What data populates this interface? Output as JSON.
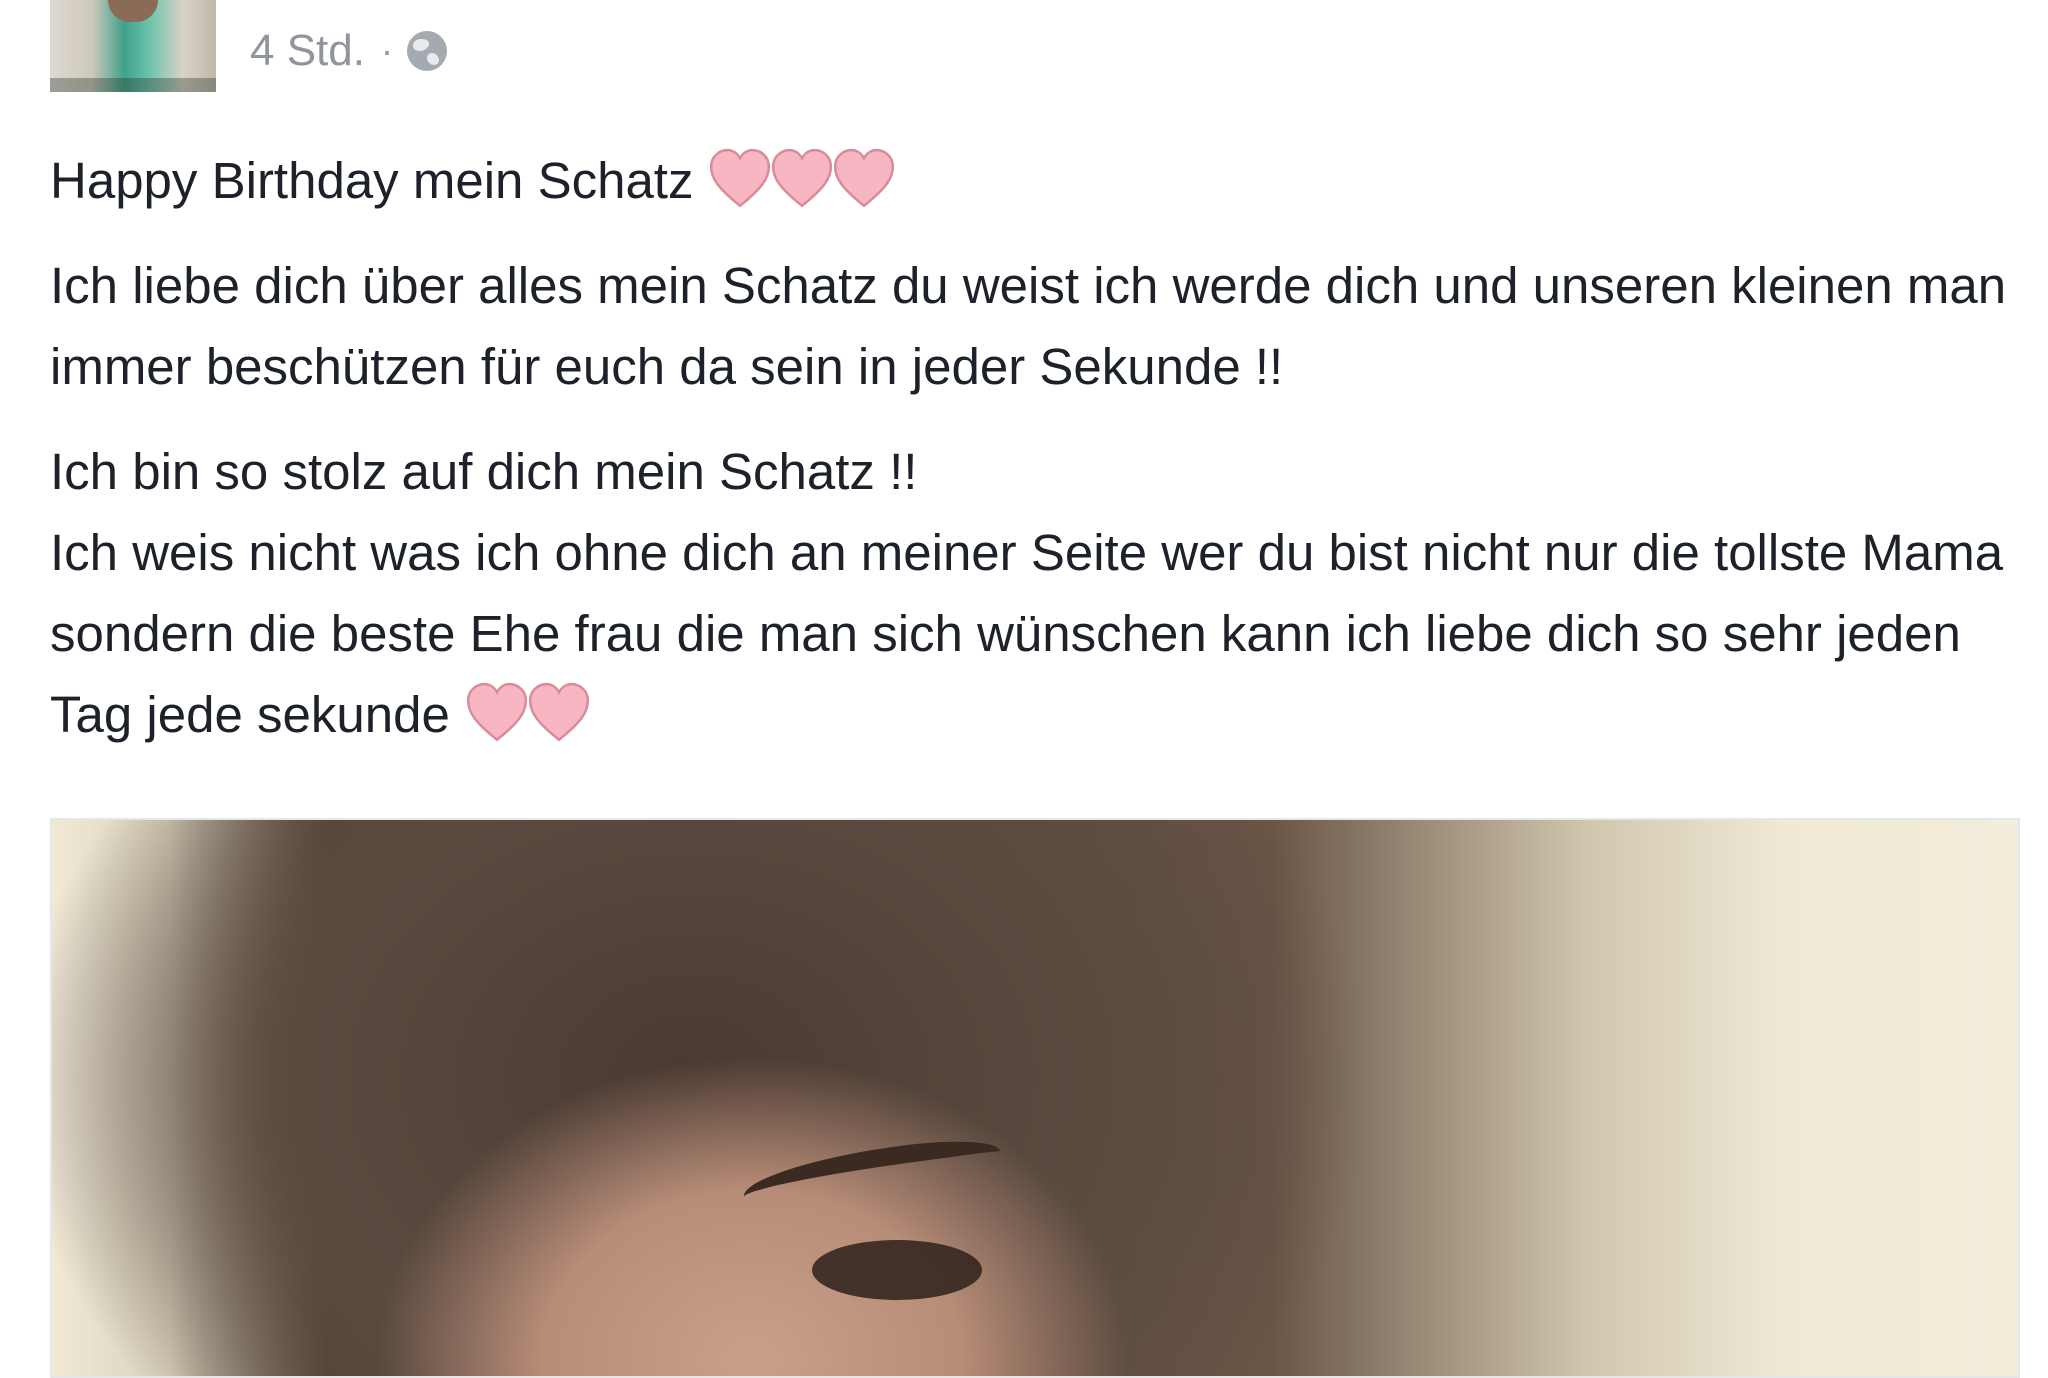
{
  "post": {
    "time": "4 Std.",
    "separator": "·",
    "privacy_icon": "globe-icon",
    "line1": "Happy Birthday mein Schatz",
    "para2": "Ich liebe dich über alles mein Schatz du weist ich werde dich und unseren kleinen man immer beschützen für euch da sein in jeder Sekunde !!",
    "line3": "Ich bin so stolz auf dich mein Schatz !!",
    "para4": "Ich weis nicht was ich ohne dich an meiner Seite wer du bist nicht nur die tollste Mama sondern die beste Ehe frau die man sich wünschen kann ich liebe dich so sehr jeden Tag jede sekunde"
  },
  "colors": {
    "text": "#1d2129",
    "meta": "#90949c",
    "heart": "#f7b6c2"
  }
}
